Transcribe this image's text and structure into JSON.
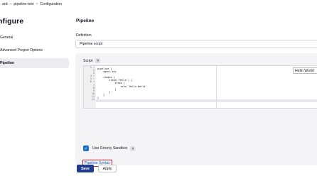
{
  "breadcrumb": {
    "items": [
      "ard",
      "pipeline-test",
      "Configuration"
    ],
    "separator": ">"
  },
  "sidebar": {
    "title": "nfigure",
    "items": [
      {
        "label": "General",
        "active": false
      },
      {
        "label": "Advanced Project Options",
        "active": false
      },
      {
        "label": "Pipeline",
        "active": true
      }
    ]
  },
  "main": {
    "section_title": "Pipeline",
    "definition_label": "Definition",
    "definition_value": "Pipeline script",
    "script_label": "Script",
    "help_glyph": "?",
    "sample_select_value": "Hello World",
    "line_numbers": [
      "1 ▾",
      "2",
      "3",
      "4 ▾",
      "5 ▾",
      "6 ▾",
      "7",
      "8",
      "9",
      "10",
      "11",
      "12"
    ],
    "code_lines": [
      "pipeline {",
      "    agent any",
      "",
      "    stages {",
      "        stage('Hello') {",
      "            steps {",
      "                echo 'Hello World'",
      "            }",
      "        }",
      "    }",
      "}",
      ""
    ],
    "sandbox_label": "Use Groovy Sandbox",
    "sandbox_checked": true,
    "syntax_link": "Pipeline Syntax"
  },
  "buttons": {
    "save": "Save",
    "apply": "Apply"
  },
  "colors": {
    "accent": "#1f3c8c",
    "link": "#1a5ec7",
    "highlight_border": "#d62020",
    "checkbox": "#1a6fc9"
  }
}
